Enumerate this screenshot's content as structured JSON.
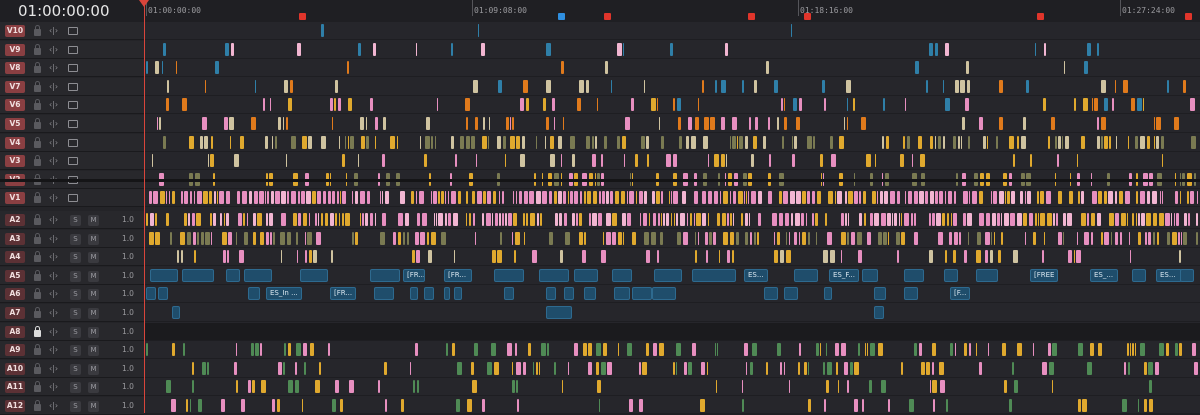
{
  "timecode": "01:00:00:00",
  "ruler": {
    "labels": [
      "01:00:00:00",
      "01:09:08:00",
      "01:18:16:00",
      "01:27:24:00"
    ],
    "marker_colors": [
      "#e0352b",
      "#2f8fe0"
    ]
  },
  "colors": {
    "pink": "#e78fc0",
    "gold": "#e0a92e",
    "orange": "#e07a1c",
    "teal": "#2f7fa8",
    "beige": "#cfc3a0",
    "olive": "#7a7a52",
    "green": "#4f8a55",
    "lightpink": "#f2b6d2",
    "audio_blue": "#1f4d6b"
  },
  "video_tracks": [
    {
      "label": "V10"
    },
    {
      "label": "V9"
    },
    {
      "label": "V8"
    },
    {
      "label": "V7"
    },
    {
      "label": "V6"
    },
    {
      "label": "V5"
    },
    {
      "label": "V4"
    },
    {
      "label": "V3"
    },
    {
      "label": "V2"
    },
    {
      "label": "V1"
    }
  ],
  "audio_tracks": [
    {
      "label": "A2",
      "solo": "S",
      "mute": "M",
      "level": "1.0"
    },
    {
      "label": "A3",
      "solo": "S",
      "mute": "M",
      "level": "1.0"
    },
    {
      "label": "A4",
      "solo": "S",
      "mute": "M",
      "level": "1.0"
    },
    {
      "label": "A5",
      "solo": "S",
      "mute": "M",
      "level": "1.0"
    },
    {
      "label": "A6",
      "solo": "S",
      "mute": "M",
      "level": "1.0"
    },
    {
      "label": "A7",
      "solo": "S",
      "mute": "M",
      "level": "1.0"
    },
    {
      "label": "A8",
      "solo": "S",
      "mute": "M",
      "level": "1.0",
      "locked": true
    },
    {
      "label": "A9",
      "solo": "S",
      "mute": "M",
      "level": "1.0"
    },
    {
      "label": "A10",
      "solo": "S",
      "mute": "M",
      "level": "1.0"
    },
    {
      "label": "A11",
      "solo": "S",
      "mute": "M",
      "level": "1.0"
    },
    {
      "label": "A12",
      "solo": "S",
      "mute": "M",
      "level": "1.0"
    }
  ],
  "a5_clip_labels": [
    "[FR...",
    "[FR...",
    "ES...",
    "ES_F...",
    "[FREE ...",
    "ES_...",
    "ES..."
  ],
  "a6_clip_labels": [
    "ES_In ...",
    "[FR...",
    "[F..."
  ]
}
